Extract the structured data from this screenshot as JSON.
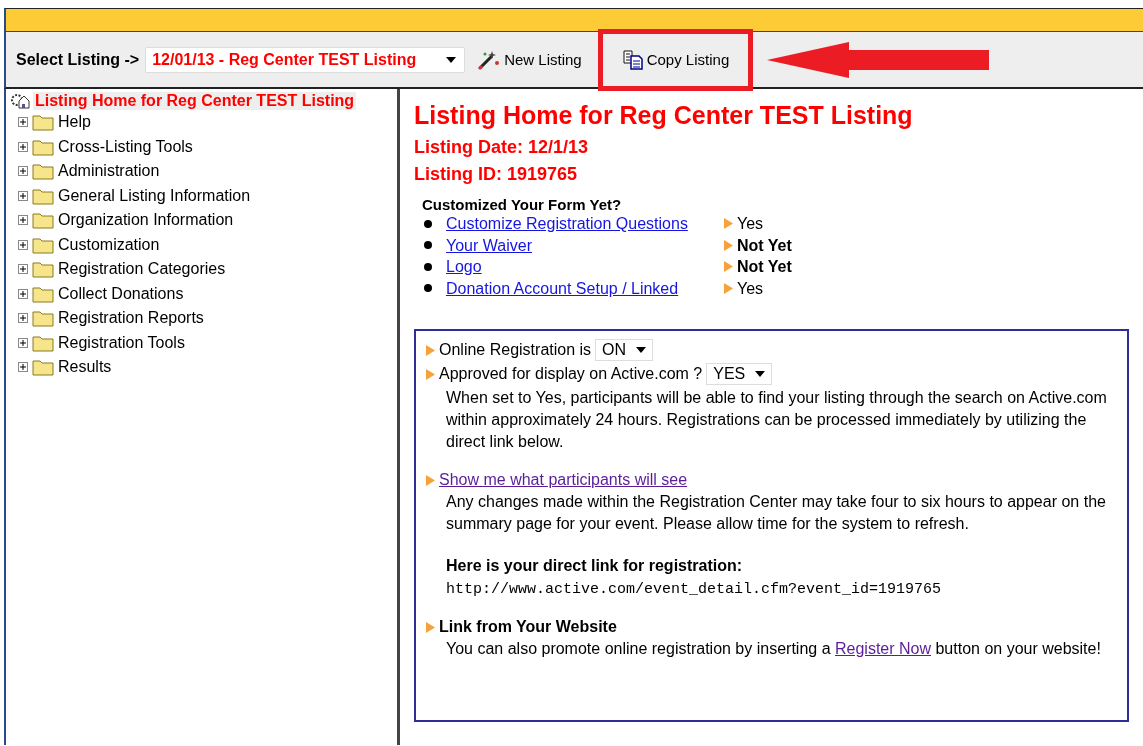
{
  "toolbar": {
    "select_label": "Select Listing ->",
    "listing_select": "12/01/13 - Reg Center TEST Listing",
    "buttons": [
      {
        "kind": "new",
        "label": "New Listing",
        "highlighted": false
      },
      {
        "kind": "copy",
        "label": "Copy Listing",
        "highlighted": true
      }
    ]
  },
  "sidebar": {
    "root": {
      "label": "Listing Home for Reg Center TEST Listing",
      "selected": true
    },
    "items": [
      {
        "label": "Help",
        "expanded": false
      },
      {
        "label": "Cross-Listing Tools",
        "expanded": false
      },
      {
        "label": "Administration",
        "expanded": false
      },
      {
        "label": "General Listing Information",
        "expanded": false
      },
      {
        "label": "Organization Information",
        "expanded": false
      },
      {
        "label": "Customization",
        "expanded": false
      },
      {
        "label": "Registration Categories",
        "expanded": false
      },
      {
        "label": "Collect Donations",
        "expanded": false
      },
      {
        "label": "Registration Reports",
        "expanded": false
      },
      {
        "label": "Registration Tools",
        "expanded": false
      },
      {
        "label": "Results",
        "expanded": false
      }
    ]
  },
  "main": {
    "title": "Listing Home for Reg Center TEST Listing",
    "listing_date": "Listing Date: 12/1/13",
    "listing_id": "Listing ID: 1919765",
    "checklist_heading": "Customized Your Form Yet?",
    "checklist": [
      {
        "link": "Customize Registration Questions",
        "status": "Yes",
        "done": true
      },
      {
        "link": "Your Waiver",
        "status": "Not Yet",
        "done": false
      },
      {
        "link": "Logo",
        "status": "Not Yet",
        "done": false
      },
      {
        "link": "Donation Account Setup / Linked",
        "status": "Yes",
        "done": true
      }
    ],
    "online_registration": {
      "label": "Online Registration is",
      "value": "ON"
    },
    "approved": {
      "label": "Approved for display on Active.com ?",
      "value": "YES"
    },
    "approved_note": "When set to Yes, participants will be able to find your listing through the search on Active.com within approximately 24 hours. Registrations can be processed immediately by utilizing the direct link below.",
    "preview_link": "Show me what participants will see",
    "preview_note": "Any changes made within the Registration Center may take four to six hours to appear on the summary page for your event. Please allow time for the system to refresh.",
    "direct_link_heading": "Here is your direct link for registration:",
    "direct_link": "http://www.active.com/event_detail.cfm?event_id=1919765",
    "website_heading": "Link from Your Website",
    "website_text_before": "You can also promote online registration by inserting a",
    "website_link": "Register Now",
    "website_text_after": "button on your website!"
  }
}
